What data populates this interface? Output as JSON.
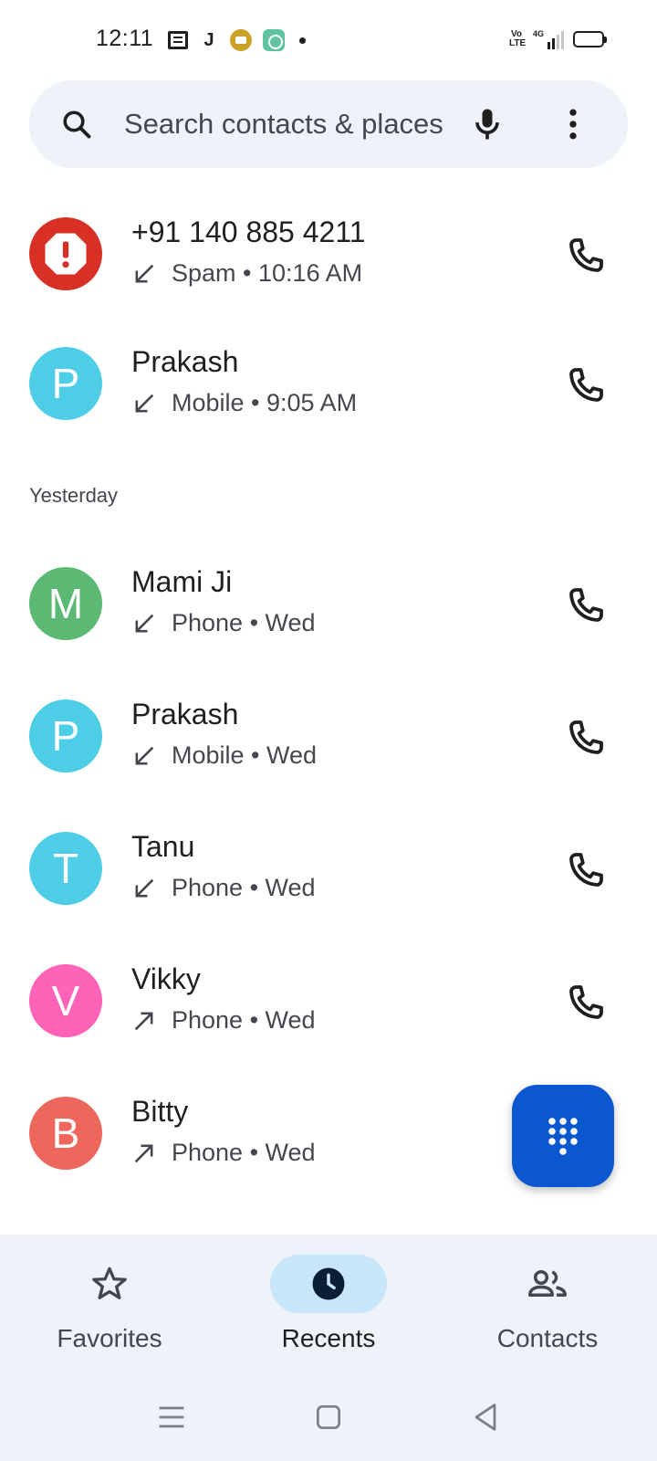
{
  "status_bar": {
    "time": "12:11",
    "network_label": "4G",
    "volte_label": "Vo LTE"
  },
  "search": {
    "placeholder": "Search contacts & places"
  },
  "recents_today": [
    {
      "name": "+91 140 885 4211",
      "direction": "incoming",
      "type": "Spam",
      "time": "10:16 AM",
      "avatar_letter": "!",
      "avatar_color": "#d93025",
      "spam": true
    },
    {
      "name": "Prakash",
      "direction": "incoming",
      "type": "Mobile",
      "time": "9:05 AM",
      "avatar_letter": "P",
      "avatar_color": "#4ecde6"
    }
  ],
  "section_yesterday": "Yesterday",
  "recents_yesterday": [
    {
      "name": "Mami Ji",
      "direction": "incoming",
      "type": "Phone",
      "time": "Wed",
      "avatar_letter": "M",
      "avatar_color": "#5bb974"
    },
    {
      "name": "Prakash",
      "direction": "incoming",
      "type": "Mobile",
      "time": "Wed",
      "avatar_letter": "P",
      "avatar_color": "#4ecde6"
    },
    {
      "name": "Tanu",
      "direction": "incoming",
      "type": "Phone",
      "time": "Wed",
      "avatar_letter": "T",
      "avatar_color": "#4ecde6"
    },
    {
      "name": "Vikky",
      "direction": "outgoing",
      "type": "Phone",
      "time": "Wed",
      "avatar_letter": "V",
      "avatar_color": "#ff63b8"
    },
    {
      "name": "Bitty",
      "direction": "outgoing",
      "type": "Phone",
      "time": "Wed",
      "avatar_letter": "B",
      "avatar_color": "#ee675c"
    }
  ],
  "bottom_nav": {
    "favorites": "Favorites",
    "recents": "Recents",
    "contacts": "Contacts",
    "active": "recents"
  },
  "icons": {
    "search": "search-icon",
    "mic": "mic-icon",
    "more": "more-vert-icon",
    "call": "phone-icon",
    "incoming": "call-received-icon",
    "outgoing": "call-made-icon",
    "dialpad": "dialpad-icon"
  },
  "colors": {
    "accent": "#0b57d0",
    "nav_active_pill": "#c7e5fb",
    "surface": "#eef2f9"
  }
}
